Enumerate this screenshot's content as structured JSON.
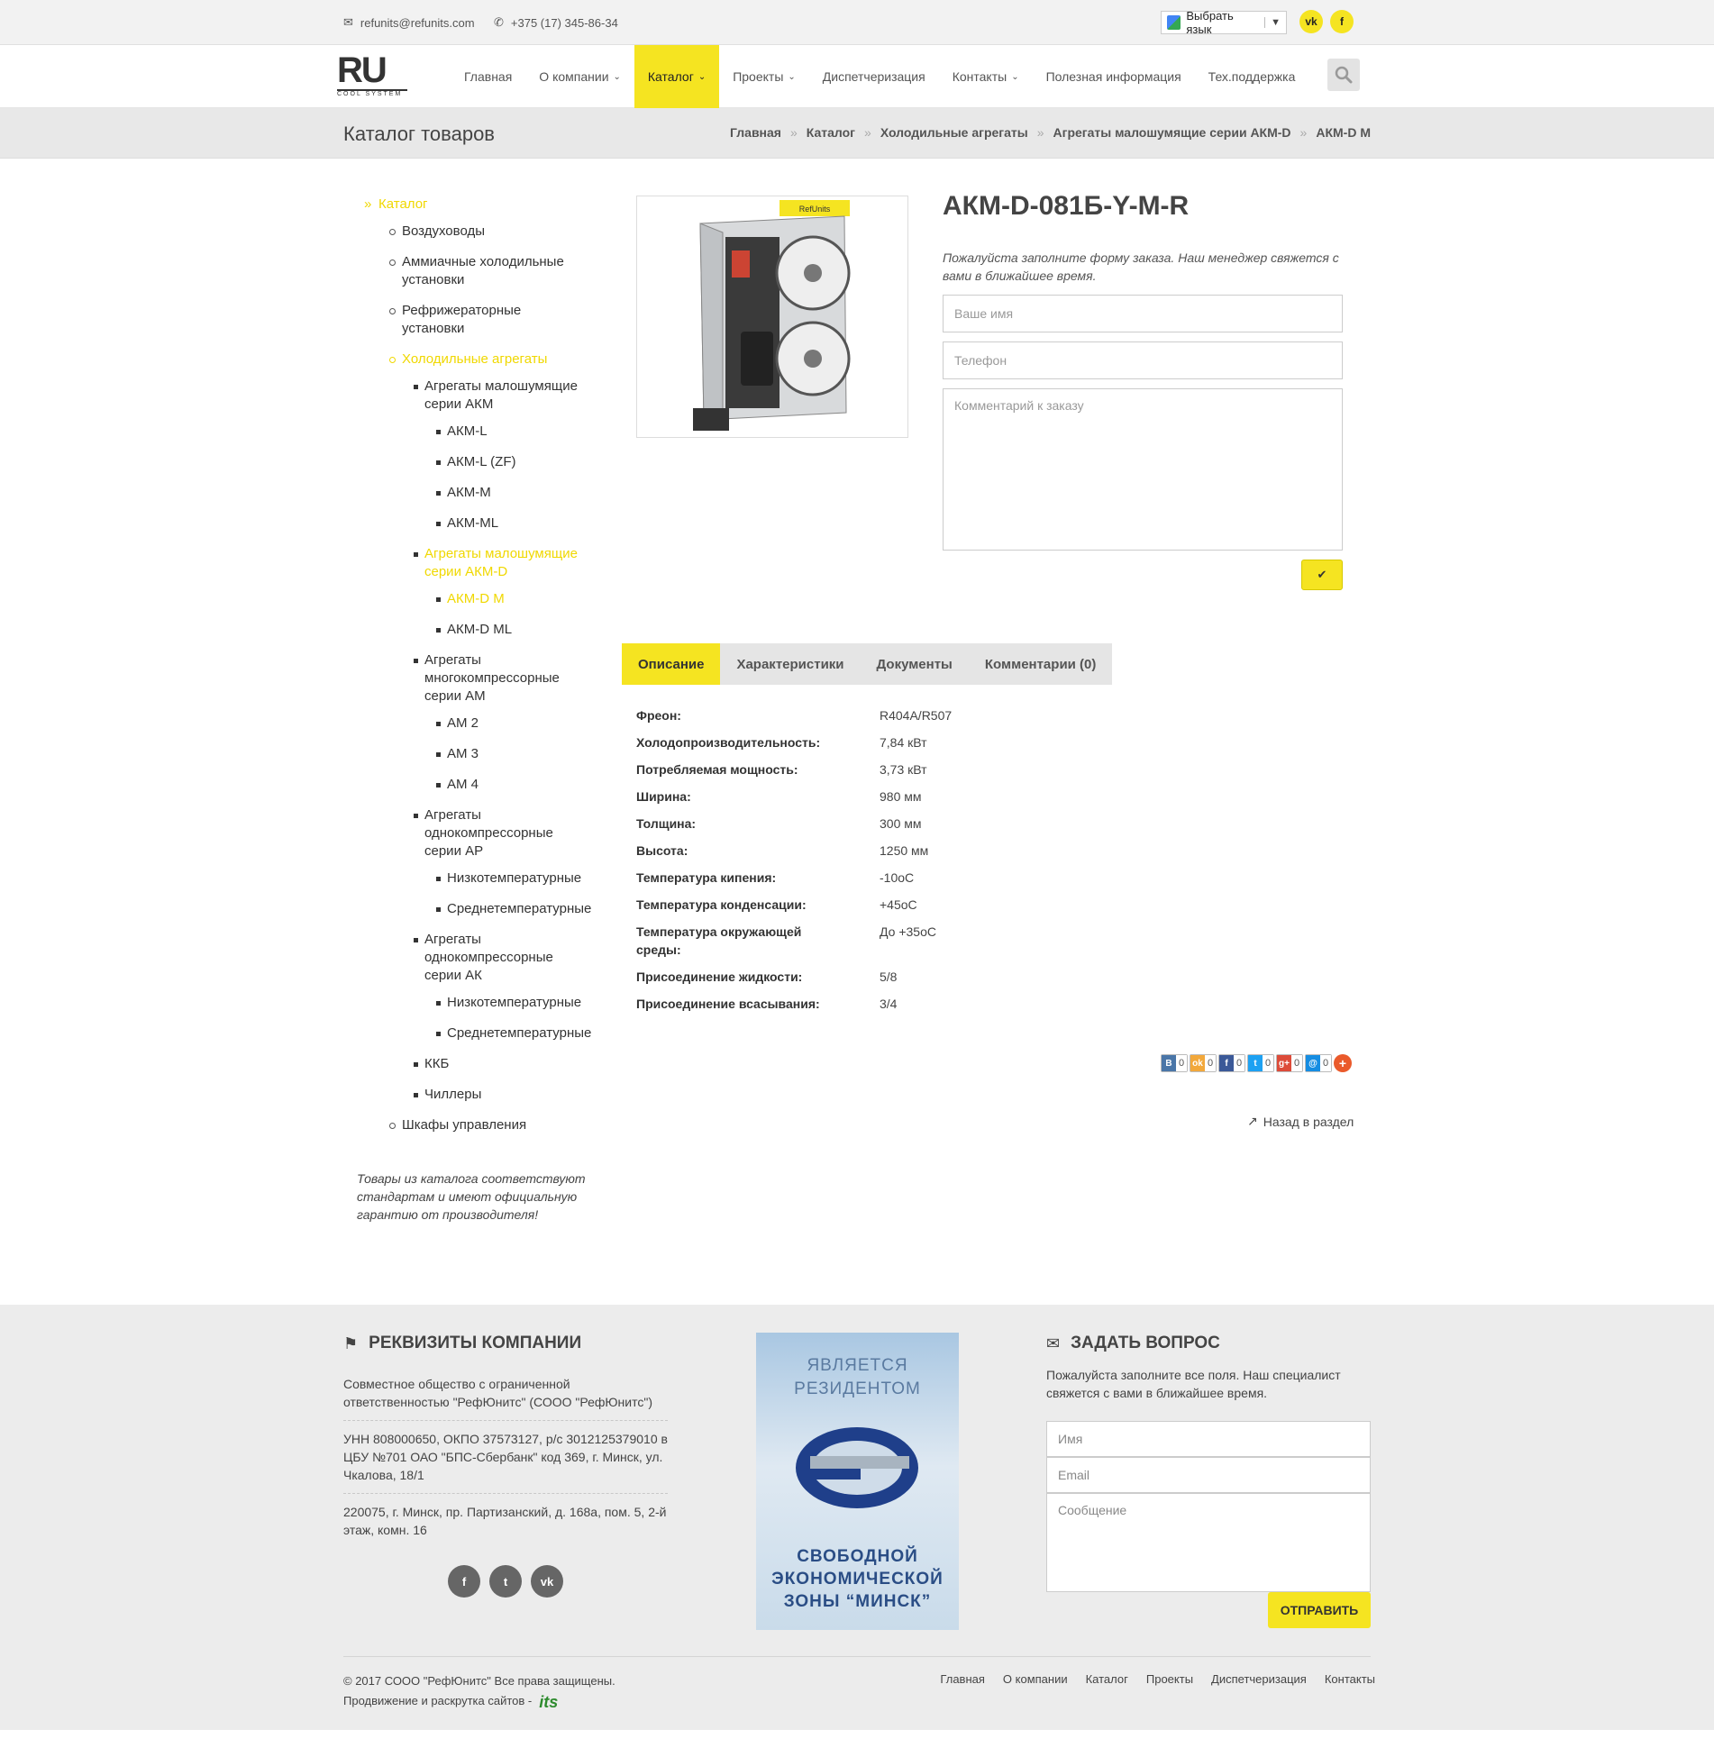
{
  "topbar": {
    "email": "refunits@refunits.com",
    "phone": "+375 (17) 345-86-34",
    "language_label": "Выбрать язык",
    "social": [
      "vk",
      "f"
    ]
  },
  "nav": {
    "logo_text": "RU",
    "logo_sub": "COOL SYSTEM",
    "items": [
      {
        "label": "Главная"
      },
      {
        "label": "О компании"
      },
      {
        "label": "Каталог"
      },
      {
        "label": "Проекты"
      },
      {
        "label": "Диспетчеризация"
      },
      {
        "label": "Контакты"
      },
      {
        "label": "Полезная информация"
      },
      {
        "label": "Тех.поддержка"
      }
    ]
  },
  "pagehead": {
    "title": "Каталог товаров",
    "breadcrumbs": [
      "Главная",
      "Каталог",
      "Холодильные агрегаты",
      "Агрегаты малошумящие серии АКМ-D",
      "АКМ-D M"
    ]
  },
  "sidebar": {
    "items": [
      {
        "label": "Каталог"
      },
      {
        "label": "Воздуховоды"
      },
      {
        "label": "Аммиачные холодильные установки"
      },
      {
        "label": "Рефрижераторные установки"
      },
      {
        "label": "Холодильные агрегаты"
      },
      {
        "label": "Агрегаты малошумящие серии АКМ"
      },
      {
        "label": "АКМ-L"
      },
      {
        "label": "АКМ-L (ZF)"
      },
      {
        "label": "АКМ-M"
      },
      {
        "label": "АКМ-ML"
      },
      {
        "label": "Агрегаты малошумящие серии АКМ-D"
      },
      {
        "label": "АКМ-D M"
      },
      {
        "label": "АКМ-D ML"
      },
      {
        "label": "Агрегаты многокомпрессорные серии АМ"
      },
      {
        "label": "АМ 2"
      },
      {
        "label": "АМ 3"
      },
      {
        "label": "АМ 4"
      },
      {
        "label": "Агрегаты однокомпрессорные серии АР"
      },
      {
        "label": "Низкотемпературные"
      },
      {
        "label": "Среднетемпературные"
      },
      {
        "label": "Агрегаты однокомпрессорные серии АК"
      },
      {
        "label": "Низкотемпературные"
      },
      {
        "label": "Среднетемпературные"
      },
      {
        "label": "ККБ"
      },
      {
        "label": "Чиллеры"
      },
      {
        "label": "Шкафы управления"
      }
    ],
    "note": "Товары из каталога соответствуют стандартам и имеют официальную гарантию от производителя!"
  },
  "product": {
    "image_brand": "RefUnits",
    "title": "АКМ-D-081Б-Y-M-R",
    "order_hint": "Пожалуйста заполните форму заказа. Наш менеджер свяжется с вами в ближайшее время.",
    "name_placeholder": "Ваше имя",
    "phone_placeholder": "Телефон",
    "comment_placeholder": "Комментарий к заказу",
    "submit_icon": "check-icon"
  },
  "tabs": [
    {
      "label": "Описание"
    },
    {
      "label": "Характеристики"
    },
    {
      "label": "Документы"
    },
    {
      "label": "Комментарии (0)"
    }
  ],
  "specs": [
    {
      "key": "Фреон:",
      "value": "R404A/R507"
    },
    {
      "key": "Холодопроизводительность:",
      "value": "7,84 кВт"
    },
    {
      "key": "Потребляемая мощность:",
      "value": "3,73 кВт"
    },
    {
      "key": "Ширина:",
      "value": "980 мм"
    },
    {
      "key": "Толщина:",
      "value": "300 мм"
    },
    {
      "key": "Высота:",
      "value": "1250 мм"
    },
    {
      "key": "Температура кипения:",
      "value": "-10оС"
    },
    {
      "key": "Температура конденсации:",
      "value": "+45оС"
    },
    {
      "key": "Температура окружающей среды:",
      "value": "До +35оС"
    },
    {
      "key": "Присоединение жидкости:",
      "value": "5/8"
    },
    {
      "key": "Присоединение всасывания:",
      "value": "3/4"
    }
  ],
  "share": [
    {
      "icon": "В",
      "count": "0",
      "color": "#4a76a8"
    },
    {
      "icon": "ok",
      "count": "0",
      "color": "#f2a83b"
    },
    {
      "icon": "f",
      "count": "0",
      "color": "#3b5998"
    },
    {
      "icon": "t",
      "count": "0",
      "color": "#1da1f2"
    },
    {
      "icon": "g+",
      "count": "0",
      "color": "#dd4b39"
    },
    {
      "icon": "@",
      "count": "0",
      "color": "#168de2"
    }
  ],
  "back_link": "Назад в раздел",
  "footer": {
    "company_heading": "РЕКВИЗИТЫ КОМПАНИИ",
    "company_name": "Совместное общество с ограниченной ответственностью \"РефЮнитс\" (СООО \"РефЮнитс\")",
    "company_reqs": "УНН 808000650, ОКПО 37573127, р/с 3012125379010 в ЦБУ №701 ОАО \"БПС-Сбербанк\" код 369, г. Минск, ул. Чкалова, 18/1",
    "company_address": "220075, г. Минск, пр. Партизанский, д. 168а, пом. 5, 2-й этаж, комн. 16",
    "social": [
      "f",
      "t",
      "vk"
    ],
    "banner_top": [
      "ЯВЛЯЕТСЯ",
      "РЕЗИДЕНТОМ"
    ],
    "banner_bottom": [
      "СВОБОДНОЙ",
      "ЭКОНОМИЧЕСКОЙ",
      "ЗОНЫ “МИНСК”"
    ],
    "ask_heading": "ЗАДАТЬ ВОПРОС",
    "ask_hint": "Пожалуйста заполните все поля. Наш специалист свяжется с вами в ближайшее время.",
    "name_placeholder": "Имя",
    "email_placeholder": "Email",
    "message_placeholder": "Сообщение",
    "send_label": "ОТПРАВИТЬ",
    "copyright": "© 2017 СООО \"РефЮнитс\" Все права защищены.",
    "promo": "Продвижение и раскрутка сайтов -",
    "promo_logo": "its",
    "menu": [
      "Главная",
      "О компании",
      "Каталог",
      "Проекты",
      "Диспетчеризация",
      "Контакты"
    ]
  }
}
